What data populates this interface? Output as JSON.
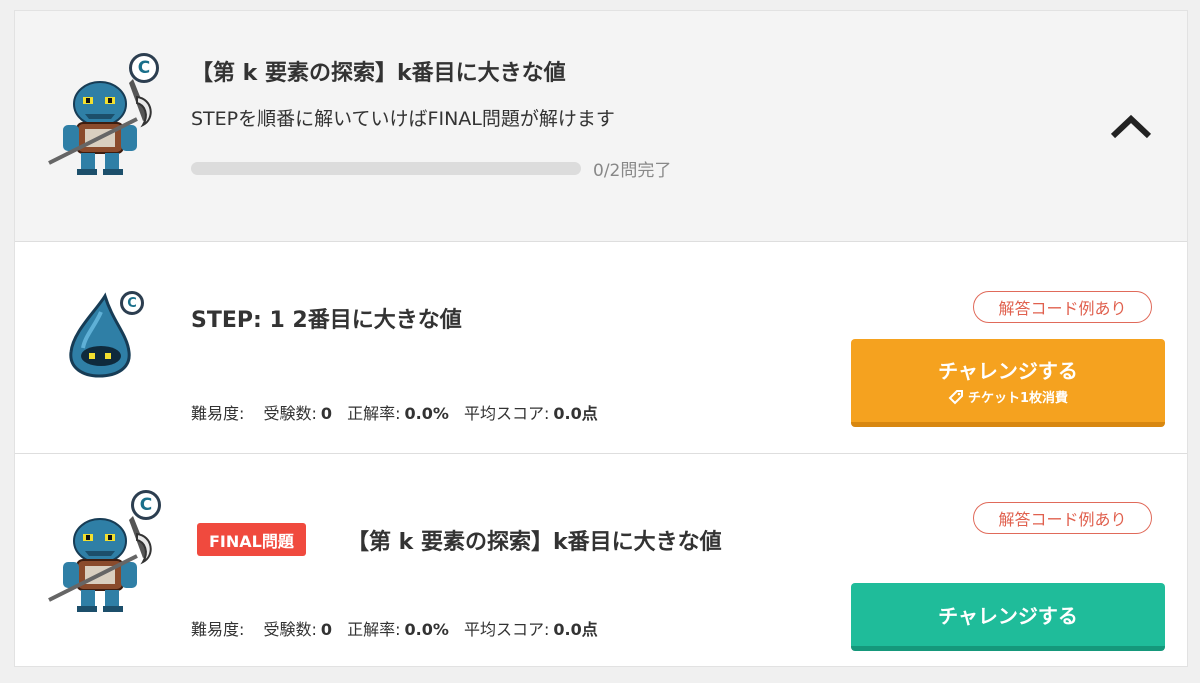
{
  "header": {
    "title": "【第 k 要素の探索】k番目に大きな値",
    "subtitle": "STEPを順番に解いていけばFINAL問題が解けます",
    "progress_fraction": 0,
    "progress_label": "0/2問完了",
    "rank_badge": "C",
    "collapse_icon": "chevron-up-icon"
  },
  "steps": [
    {
      "title": "STEP: 1 2番目に大きな値",
      "rank_badge": "C",
      "tag": "解答コード例あり",
      "button_label": "チャレンジする",
      "button_sub": "チケット1枚消費",
      "stats": {
        "difficulty_label": "難易度:",
        "examinees_label": "受験数:",
        "examinees": "0",
        "accuracy_label": "正解率:",
        "accuracy": "0.0%",
        "avg_label": "平均スコア:",
        "avg": "0.0点"
      },
      "button_color": "#f5a21f"
    },
    {
      "badge": "FINAL問題",
      "title": "【第 k 要素の探索】k番目に大きな値",
      "rank_badge": "C",
      "tag": "解答コード例あり",
      "button_label": "チャレンジする",
      "stats": {
        "difficulty_label": "難易度:",
        "examinees_label": "受験数:",
        "examinees": "0",
        "accuracy_label": "正解率:",
        "accuracy": "0.0%",
        "avg_label": "平均スコア:",
        "avg": "0.0点"
      },
      "button_color": "#1fbc9a"
    }
  ],
  "colors": {
    "accent_orange": "#f5a21f",
    "accent_green": "#1fbc9a",
    "final_red": "#f04a3e"
  }
}
